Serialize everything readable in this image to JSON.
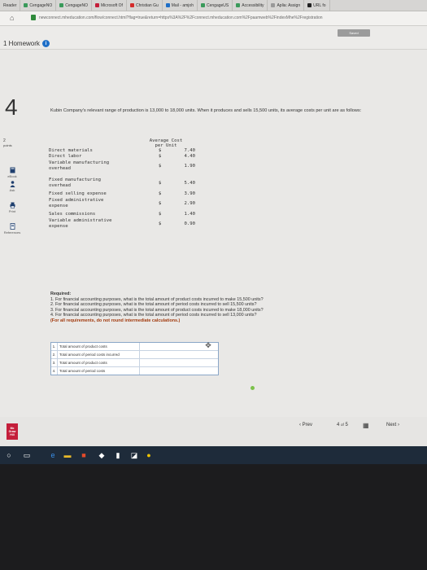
{
  "browser": {
    "tabs": [
      "Reader",
      "CengageNO",
      "CengageNO",
      "Microsoft Of",
      "Christian Gu",
      "Mail - amjoh",
      "CengageUS",
      "Accessibility",
      "Aplia: Assign",
      "URL fo"
    ],
    "url": "newconnect.mheducation.com/flow/connect.html?flag=true&return=https%3A%2F%2Fconnect.mheducation.com%2Fpaamweb%2FindexMhe%2Fregistration"
  },
  "header": {
    "saved_label": "Saved",
    "homework_title": "1 Homework",
    "info_icon": "i"
  },
  "question": {
    "number": "4",
    "points_value": "2",
    "points_label": "points",
    "intro": "Kubin Company's relevant range of production is 13,000 to 18,000 units. When it produces and sells 15,500 units, its average costs per unit are as follows:"
  },
  "rail": {
    "ebook": "eBook",
    "ask": "Ask",
    "print": "Print",
    "references": "References"
  },
  "cost_table": {
    "header_line1": "Average Cost",
    "header_line2": "per Unit",
    "rows": [
      {
        "label": "Direct materials",
        "currency": "$",
        "value": "7.40"
      },
      {
        "label": "Direct labor",
        "currency": "$",
        "value": "4.40"
      },
      {
        "label": "Variable manufacturing",
        "label2": "overhead",
        "currency": "$",
        "value": "1.90"
      },
      {
        "label": "Fixed manufacturing",
        "label2": "overhead",
        "currency": "$",
        "value": "5.40"
      },
      {
        "label": "Fixed selling expense",
        "currency": "$",
        "value": "3.90"
      },
      {
        "label": "Fixed administrative",
        "label2": "expense",
        "currency": "$",
        "value": "2.90"
      },
      {
        "label": "Sales commissions",
        "currency": "$",
        "value": "1.40"
      },
      {
        "label": "Variable administrative",
        "label2": "expense",
        "currency": "$",
        "value": "0.90"
      }
    ]
  },
  "required": {
    "title": "Required:",
    "items": [
      "1. For financial accounting purposes, what is the total amount of product costs incurred to make 15,500 units?",
      "2. For financial accounting purposes, what is the total amount of period costs incurred to sell 15,500 units?",
      "3. For financial accounting purposes, what is the total amount of product costs incurred to make 18,000 units?",
      "4. For financial accounting purposes, what is the total amount of period costs incurred to sell 13,000 units?"
    ],
    "note": "(For all requirements, do not round intermediate calculations.)"
  },
  "answers": [
    {
      "num": "1.",
      "label": "Total amount of product costs",
      "value": ""
    },
    {
      "num": "2.",
      "label": "Total amount of period costs incurred",
      "value": ""
    },
    {
      "num": "3.",
      "label": "Total amount of product costs",
      "value": ""
    },
    {
      "num": "4.",
      "label": "Total amount of period costs",
      "value": ""
    }
  ],
  "nav": {
    "prev": "‹  Prev",
    "page_current": "4",
    "page_sep": "of",
    "page_total": "5",
    "next": "Next  ›",
    "logo": "Mc Graw Hill"
  },
  "colors": {
    "accent": "#1f6fc7",
    "brand_red": "#c41e3a",
    "note_text": "#a23b0f"
  }
}
